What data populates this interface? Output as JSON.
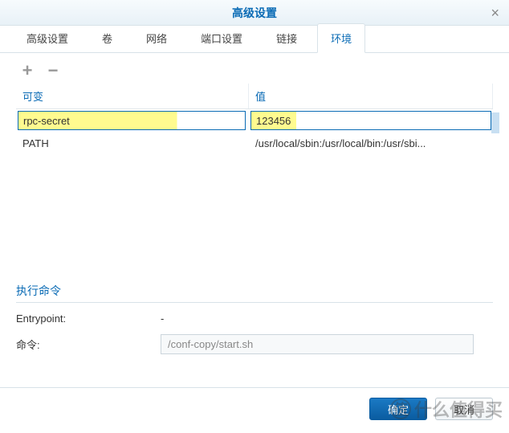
{
  "dialog": {
    "title": "高级设置",
    "close": "×"
  },
  "tabs": [
    {
      "label": "高级设置",
      "active": false
    },
    {
      "label": "卷",
      "active": false
    },
    {
      "label": "网络",
      "active": false
    },
    {
      "label": "端口设置",
      "active": false
    },
    {
      "label": "链接",
      "active": false
    },
    {
      "label": "环境",
      "active": true
    }
  ],
  "toolbar": {
    "add": "+",
    "remove": "−"
  },
  "env_table": {
    "headers": {
      "variable": "可变",
      "value": "值"
    },
    "rows": [
      {
        "variable": "rpc-secret",
        "value": "123456",
        "selected": true,
        "highlighted": true
      },
      {
        "variable": "PATH",
        "value": "/usr/local/sbin:/usr/local/bin:/usr/sbi...",
        "selected": false,
        "highlighted": false
      }
    ]
  },
  "exec_section": {
    "title": "执行命令",
    "entrypoint_label": "Entrypoint:",
    "entrypoint_value": "-",
    "command_label": "命令:",
    "command_value": "/conf-copy/start.sh"
  },
  "footer": {
    "ok": "确定",
    "cancel": "取消"
  },
  "watermark": {
    "icon": "值",
    "text": "什么值得买"
  }
}
